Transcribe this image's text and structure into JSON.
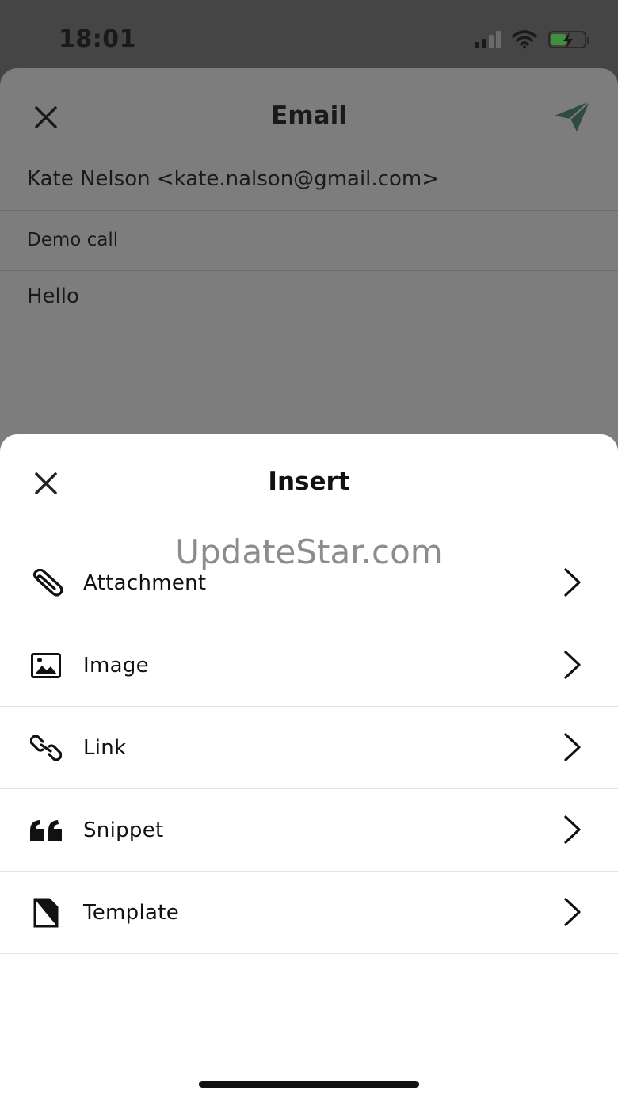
{
  "status_bar": {
    "time": "18:01",
    "icons": [
      "signal-icon",
      "wifi-icon",
      "battery-charging-icon"
    ]
  },
  "email": {
    "title": "Email",
    "to": "Kate Nelson <kate.nalson@gmail.com>",
    "subject": "Demo call",
    "body": "Hello",
    "send_icon": "send-icon",
    "close_icon": "close-icon"
  },
  "insert": {
    "title": "Insert",
    "close_icon": "close-icon",
    "watermark": "UpdateStar.com",
    "items": [
      {
        "label": "Attachment",
        "icon": "paperclip-icon"
      },
      {
        "label": "Image",
        "icon": "image-icon"
      },
      {
        "label": "Link",
        "icon": "link-icon"
      },
      {
        "label": "Snippet",
        "icon": "quote-icon"
      },
      {
        "label": "Template",
        "icon": "template-file-icon"
      }
    ]
  },
  "colors": {
    "backdrop": "#454545",
    "dimmed_sheet": "#7d7d7d",
    "send_accent": "#2f4a3e",
    "battery_fill": "#3f8f3f"
  }
}
